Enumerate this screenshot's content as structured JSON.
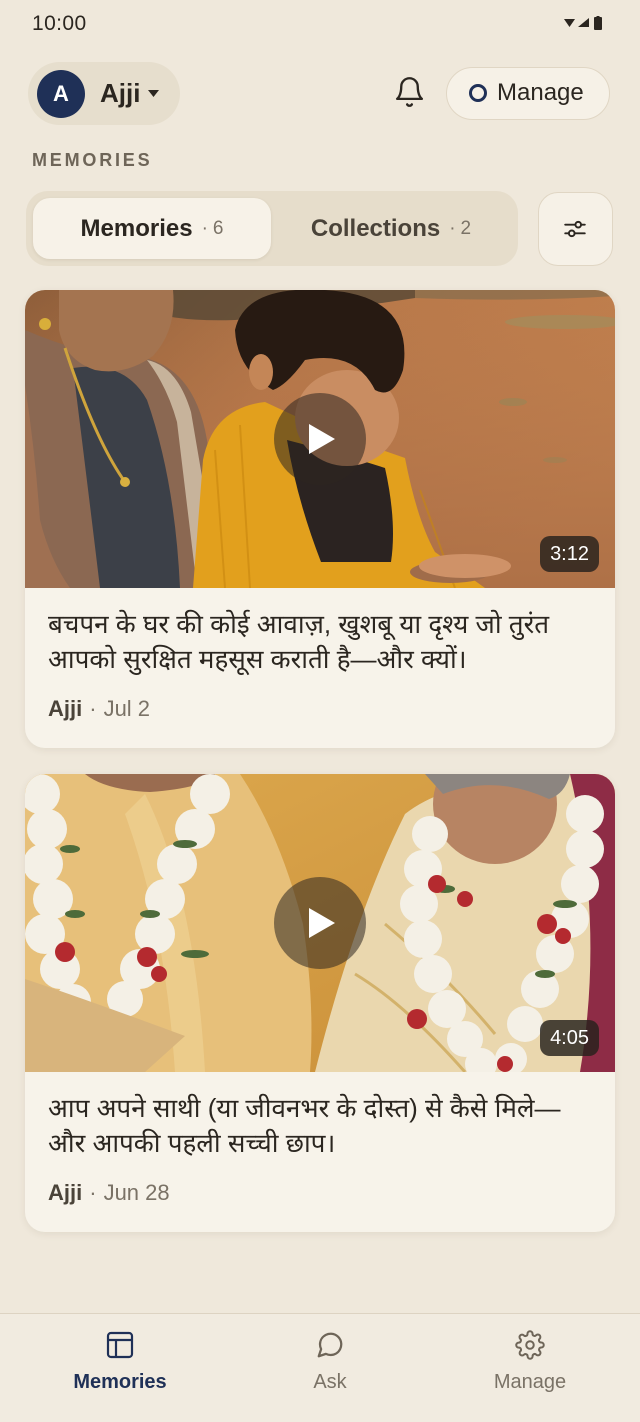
{
  "status_bar": {
    "time": "10:00",
    "icons": [
      "wifi-icon",
      "signal-icon",
      "battery-icon"
    ]
  },
  "header": {
    "profile": {
      "initial": "A",
      "name": "Ajji",
      "dropdown_icon": "caret-down-icon"
    },
    "notifications_icon": "bell-icon",
    "manage_button": {
      "label": "Manage",
      "icon": "circle-icon"
    }
  },
  "section_label": "MEMORIES",
  "tabs": [
    {
      "label": "Memories",
      "separator": "·",
      "count": 6,
      "selected": true
    },
    {
      "label": "Collections",
      "separator": "·",
      "count": 2,
      "selected": false
    }
  ],
  "filter_button": {
    "icon": "sliders-icon"
  },
  "memories": [
    {
      "title": "बचपन के घर की कोई आवाज़, खुशबू या दृश्य जो तुरंत आपको सुरक्षित महसूस कराती है—और क्यों।",
      "author": "Ajji",
      "separator": "·",
      "date": "Jul 2",
      "duration": "3:12",
      "overlay_icon": "play-icon"
    },
    {
      "title": "आप अपने साथी (या जीवनभर के दोस्त) से कैसे मिले—और आपकी पहली सच्ची छाप।",
      "author": "Ajji",
      "separator": "·",
      "date": "Jun 28",
      "duration": "4:05",
      "overlay_icon": "play-icon"
    }
  ],
  "bottom_nav": {
    "items": [
      {
        "label": "Memories",
        "icon": "memories-icon",
        "active": true
      },
      {
        "label": "Ask",
        "icon": "chat-icon",
        "active": false
      },
      {
        "label": "Manage",
        "icon": "gear-icon",
        "active": false
      }
    ]
  },
  "colors": {
    "background": "#EFE8DB",
    "card": "#F7F3EA",
    "accent": "#1F3057",
    "text": "#2B2620",
    "muted": "#7A7266"
  }
}
